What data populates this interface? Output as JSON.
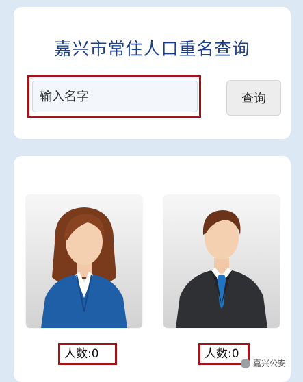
{
  "search": {
    "title": "嘉兴市常住人口重名查询",
    "input_placeholder": "输入名字",
    "button_label": "查询"
  },
  "results": {
    "female_count_label": "人数:0",
    "male_count_label": "人数:0"
  },
  "watermark": {
    "text": "嘉兴公安"
  },
  "colors": {
    "title": "#1d3f8a",
    "highlight_border": "#a1141a",
    "background": "#dce9f4"
  },
  "icons": [
    "female-avatar-icon",
    "male-avatar-icon"
  ]
}
